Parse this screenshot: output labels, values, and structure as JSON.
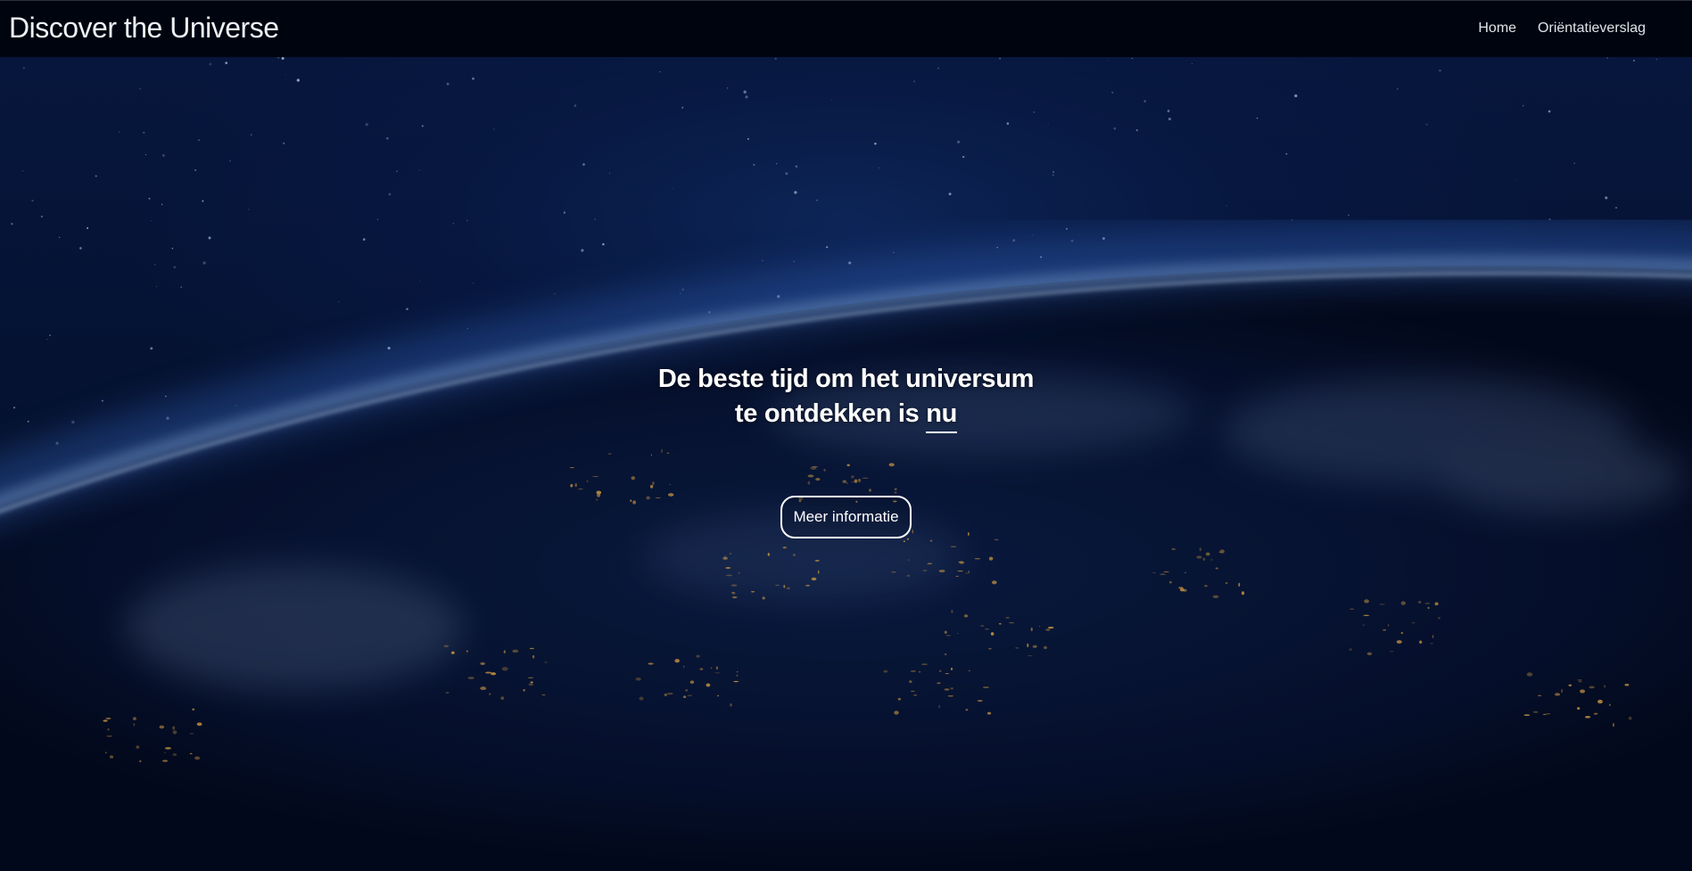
{
  "navbar": {
    "brand": "Discover the Universe",
    "links": [
      {
        "label": "Home"
      },
      {
        "label": "Oriëntatieverslag"
      }
    ]
  },
  "hero": {
    "headline_line1": "De beste tijd om het universum",
    "headline_line2_prefix": "te ontdekken is ",
    "headline_accent": "nu",
    "cta_label": "Meer informatie"
  },
  "colors": {
    "navbar_background": "#00040f",
    "page_background": "#03081a",
    "text": "#ffffff",
    "city_lights": "#e0a64a"
  }
}
